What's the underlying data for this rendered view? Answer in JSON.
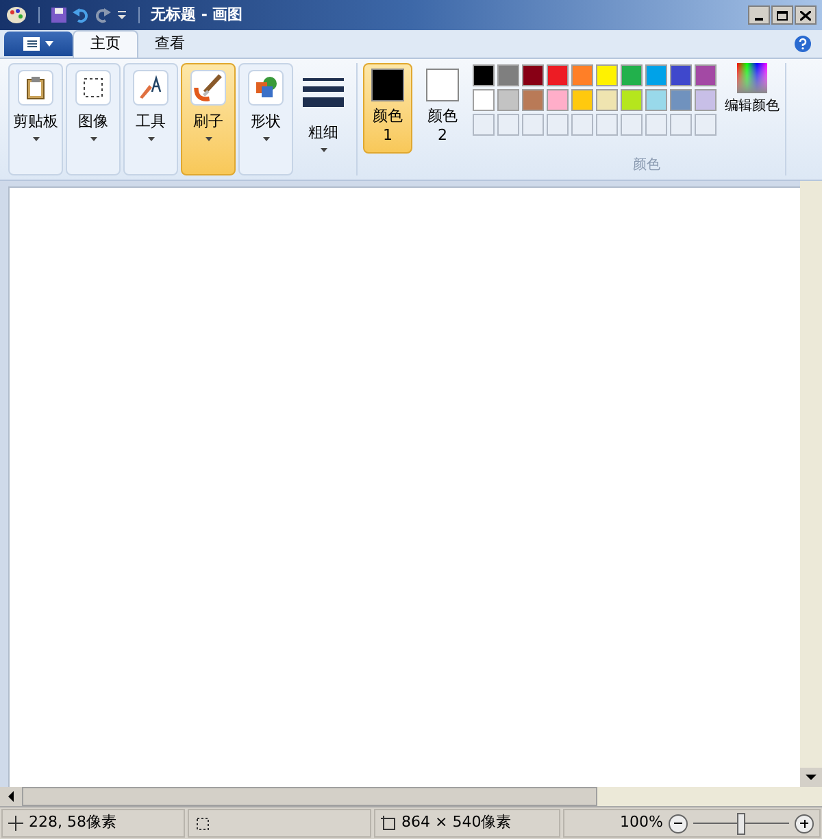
{
  "window": {
    "title": "无标题 - 画图"
  },
  "tabs": [
    {
      "label": "主页",
      "selected": true
    },
    {
      "label": "查看",
      "selected": false
    }
  ],
  "tools": [
    {
      "label": "剪贴板",
      "kind": "clipboard",
      "selected": false
    },
    {
      "label": "图像",
      "kind": "image",
      "selected": false
    },
    {
      "label": "工具",
      "kind": "tools",
      "selected": false
    },
    {
      "label": "刷子",
      "kind": "brush",
      "selected": true
    },
    {
      "label": "形状",
      "kind": "shapes",
      "selected": false
    },
    {
      "label": "粗细",
      "kind": "size",
      "selected": false
    }
  ],
  "color_slots": [
    {
      "label": "颜色 1",
      "color": "#000000",
      "selected": true
    },
    {
      "label": "颜色 2",
      "color": "#ffffff",
      "selected": false
    }
  ],
  "palette": [
    [
      {
        "color": "#000000"
      },
      {
        "color": "#7f7f7f"
      },
      {
        "color": "#880015"
      },
      {
        "color": "#ed1c24"
      },
      {
        "color": "#ff7f27"
      },
      {
        "color": "#fff200"
      },
      {
        "color": "#22b14c"
      },
      {
        "color": "#00a2e8"
      },
      {
        "color": "#3f48cc"
      },
      {
        "color": "#a349a4"
      }
    ],
    [
      {
        "color": "#ffffff"
      },
      {
        "color": "#c3c3c3"
      },
      {
        "color": "#b97a57"
      },
      {
        "color": "#ffaec9"
      },
      {
        "color": "#ffc90e"
      },
      {
        "color": "#efe4b0"
      },
      {
        "color": "#b5e61d"
      },
      {
        "color": "#99d9ea"
      },
      {
        "color": "#7092be"
      },
      {
        "color": "#c8bfe7"
      }
    ],
    [
      {
        "kind": "empty"
      },
      {
        "kind": "empty"
      },
      {
        "kind": "empty"
      },
      {
        "kind": "empty"
      },
      {
        "kind": "empty"
      },
      {
        "kind": "empty"
      },
      {
        "kind": "empty"
      },
      {
        "kind": "empty"
      },
      {
        "kind": "empty"
      },
      {
        "kind": "empty"
      }
    ]
  ],
  "edit_colors": "编辑颜色",
  "colors_group": "颜色",
  "status_bar": {
    "cursor": "228, 58像素",
    "size": "864 × 540像素",
    "zoom": "100%",
    "zoom_slider": {
      "level": 0.5
    }
  }
}
